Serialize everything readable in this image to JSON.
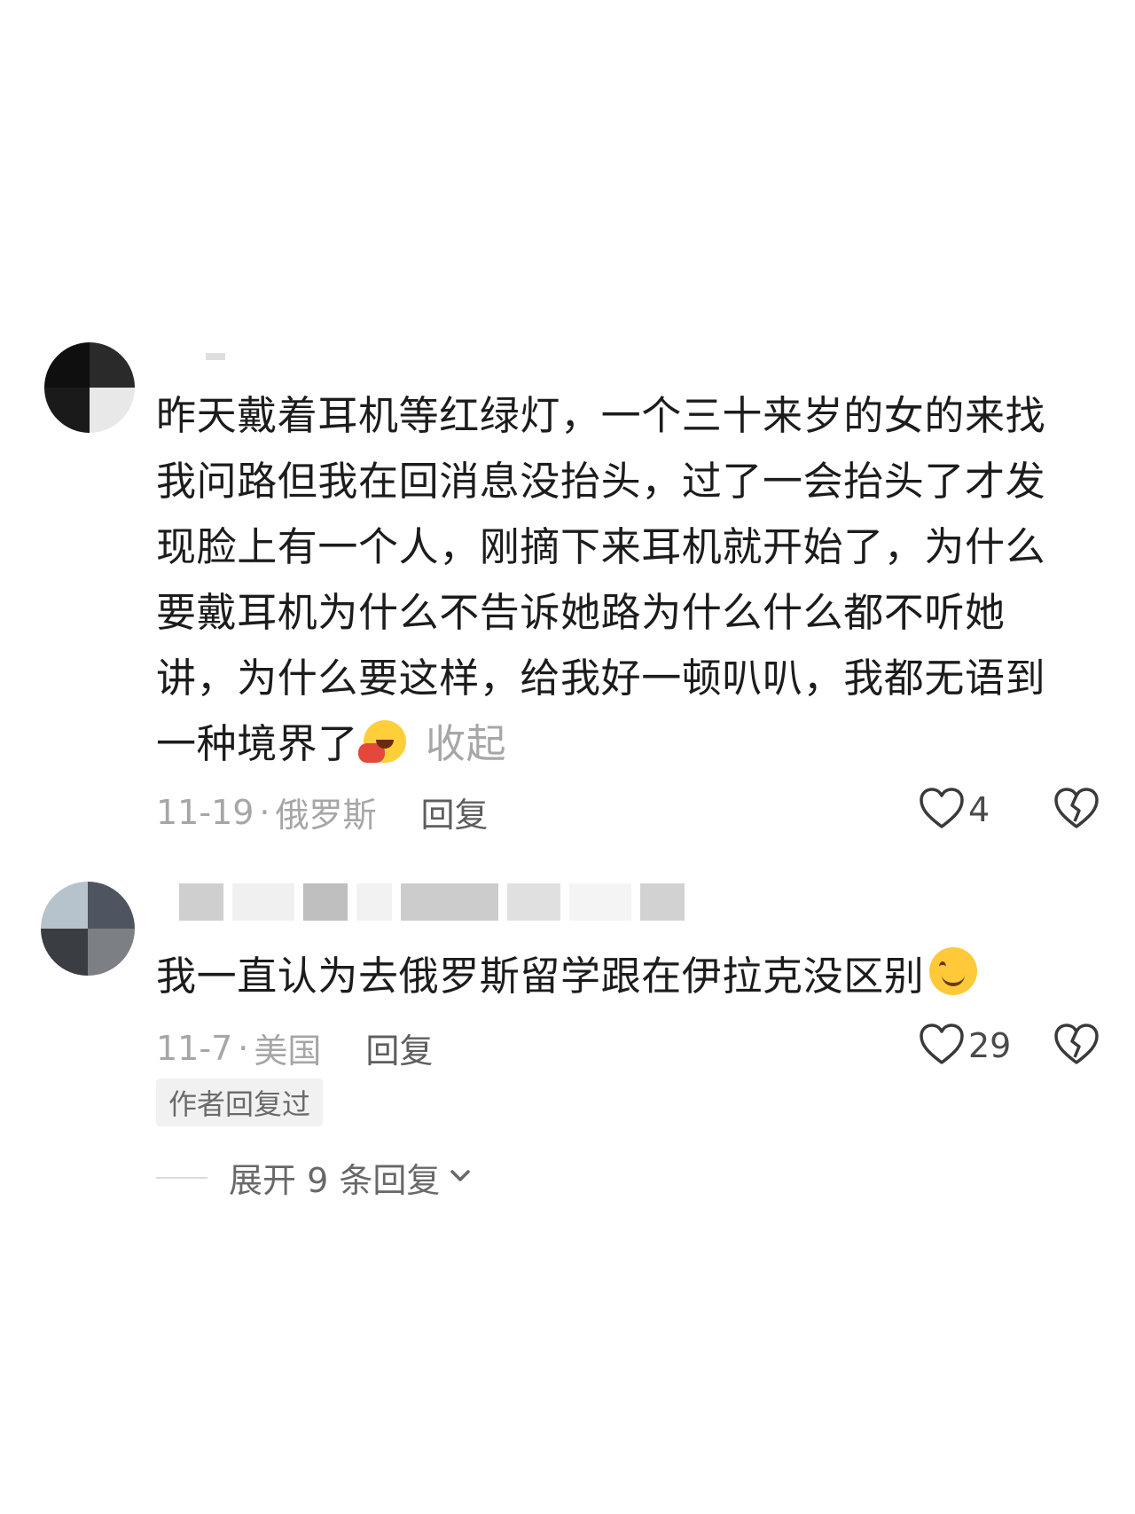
{
  "comments": [
    {
      "text": "昨天戴着耳机等红绿灯，一个三十来岁的女的来找我问路但我在回消息没抬头，过了一会抬头了才发现脸上有一个人，刚摘下来耳机就开始了，为什么要戴耳机为什么不告诉她路为什么什么都不听她讲，为什么要这样，给我好一顿叭叭，我都无语到一种境界了",
      "emoji": "laugh-emoji",
      "collapse_label": "收起",
      "date": "11-19",
      "location": "俄罗斯",
      "reply_label": "回复",
      "likes": "4"
    },
    {
      "text": "我一直认为去俄罗斯留学跟在伊拉克没区别",
      "emoji": "smile-emoji",
      "date": "11-7",
      "location": "美国",
      "reply_label": "回复",
      "likes": "29",
      "badge": "作者回复过",
      "expand_label": "展开 9 条回复"
    }
  ],
  "icons": [
    "heart-outline-icon",
    "broken-heart-icon",
    "chevron-down-icon"
  ]
}
